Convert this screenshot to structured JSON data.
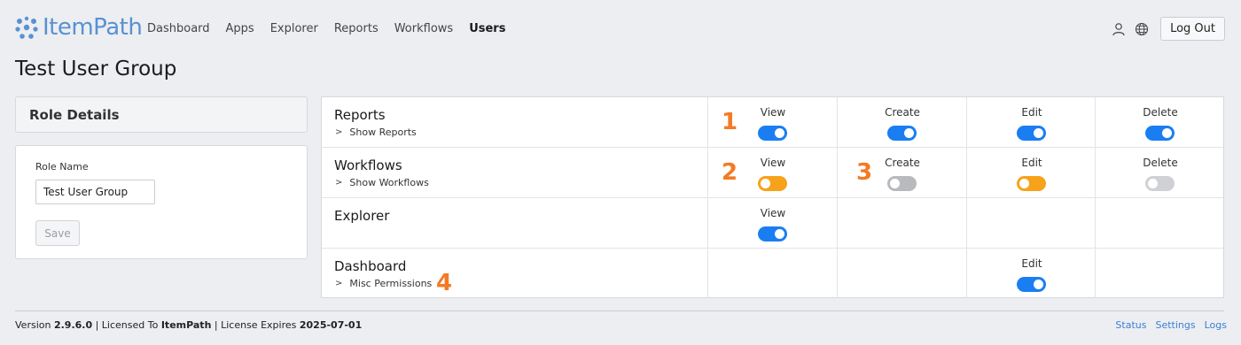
{
  "header": {
    "logo_text": "ItemPath",
    "nav": [
      "Dashboard",
      "Apps",
      "Explorer",
      "Reports",
      "Workflows",
      "Users"
    ],
    "active_nav": "Users",
    "icons": [
      "user-icon",
      "globe-icon"
    ],
    "logout_label": "Log Out"
  },
  "page_title": "Test User Group",
  "role_details": {
    "title": "Role Details",
    "name_label": "Role Name",
    "name_value": "Test User Group",
    "save_label": "Save"
  },
  "permissions": {
    "rows": [
      {
        "name": "Reports",
        "sub": "Show Reports",
        "callout": "1",
        "cells": [
          {
            "label": "View",
            "state": "on",
            "color": "#1a7ef2"
          },
          {
            "label": "Create",
            "state": "on",
            "color": "#1a7ef2"
          },
          {
            "label": "Edit",
            "state": "on",
            "color": "#1a7ef2"
          },
          {
            "label": "Delete",
            "state": "on",
            "color": "#1a7ef2"
          }
        ]
      },
      {
        "name": "Workflows",
        "sub": "Show Workflows",
        "callout": "2",
        "callout_create": "3",
        "cells": [
          {
            "label": "View",
            "state": "off",
            "color": "#f7a21b"
          },
          {
            "label": "Create",
            "state": "off",
            "color": "#b8babd"
          },
          {
            "label": "Edit",
            "state": "off",
            "color": "#f7a21b"
          },
          {
            "label": "Delete",
            "state": "off",
            "color": "#cfd1d4"
          }
        ]
      },
      {
        "name": "Explorer",
        "cells": [
          {
            "label": "View",
            "state": "on",
            "color": "#1a7ef2"
          }
        ]
      },
      {
        "name": "Dashboard",
        "sub": "Misc Permissions",
        "callout": "4",
        "cells": [
          {
            "label": "Edit",
            "state": "on",
            "color": "#1a7ef2"
          }
        ]
      }
    ]
  },
  "footer": {
    "version_prefix": "Version ",
    "version": "2.9.6.0",
    "licensed_prefix": " | Licensed To ",
    "licensee": "ItemPath",
    "expires_prefix": " | License Expires ",
    "expires": "2025-07-01",
    "links": [
      "Status",
      "Settings",
      "Logs"
    ]
  },
  "colors": {
    "accent_blue": "#1a7ef2",
    "toggle_orange": "#f7a21b",
    "callout_orange": "#f47a24",
    "logo_blue": "#5a91d0"
  }
}
